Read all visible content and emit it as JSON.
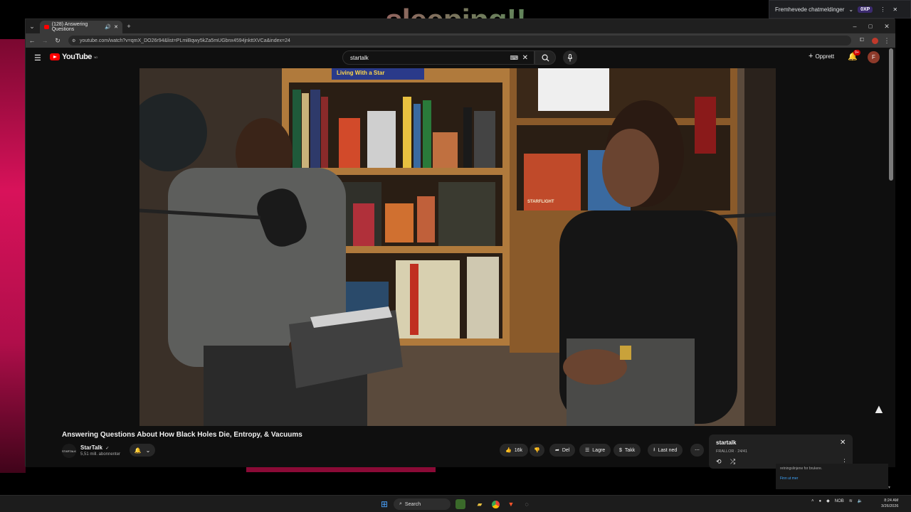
{
  "overlay": {
    "text": "sleeping!!"
  },
  "top_widget": {
    "label": "Fremhevede chatmeldinger",
    "badge": "0XP"
  },
  "browser": {
    "tab_title": "(128) Answering Questions",
    "url": "youtube.com/watch?v=qmX_DO26r94&list=PLmiBqwy5kZa5mUGbnx4594jnkttXVCa&index=24"
  },
  "youtube": {
    "logo_text": "YouTube",
    "logo_region": "NO",
    "search_value": "startalk",
    "create_label": "Opprett",
    "notif_count": "9+",
    "avatar_initial": "F"
  },
  "video": {
    "title": "Answering Questions About How Black Holes Die, Entropy, & Vacuums",
    "shelf_sign": "Living With a Star",
    "book_sign": "STARFLIGHT"
  },
  "channel": {
    "avatar_text": "STARTALK",
    "name": "StarTalk",
    "verified": "✓",
    "subs": "5,51 mill. abonnenter"
  },
  "actions": {
    "like_count": "16k",
    "share": "Del",
    "save": "Lagre",
    "thanks": "Takk",
    "download": "Last ned"
  },
  "playlist": {
    "title": "startalk",
    "subtitle": "FRALLOR · 24/41"
  },
  "notif_popup": {
    "text": "retningslinjene for brukere.",
    "link": "Finn ut mer"
  },
  "taskbar": {
    "search": "Search",
    "tray_lang": "NOB",
    "time": "8:24 AM",
    "date": "3/26/2026"
  }
}
